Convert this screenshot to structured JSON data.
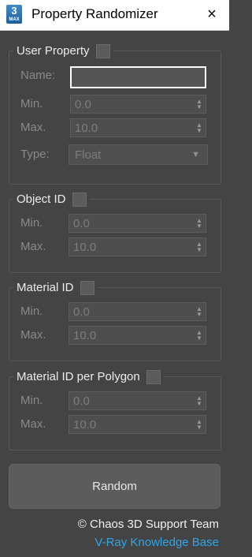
{
  "window": {
    "title": "Property Randomizer",
    "app_icon_main": "3",
    "app_icon_sub": "MAX",
    "close_icon": "×"
  },
  "user_property": {
    "legend": "User Property",
    "enabled": false,
    "name_label": "Name:",
    "name_value": "",
    "min_label": "Min.",
    "min_value": "0.0",
    "max_label": "Max.",
    "max_value": "10.0",
    "type_label": "Type:",
    "type_value": "Float"
  },
  "object_id": {
    "legend": "Object ID",
    "enabled": false,
    "min_label": "Min.",
    "min_value": "0.0",
    "max_label": "Max.",
    "max_value": "10.0"
  },
  "material_id": {
    "legend": "Material ID",
    "enabled": false,
    "min_label": "Min.",
    "min_value": "0.0",
    "max_label": "Max.",
    "max_value": "10.0"
  },
  "material_id_per_polygon": {
    "legend": "Material ID per Polygon",
    "enabled": false,
    "min_label": "Min.",
    "min_value": "0.0",
    "max_label": "Max.",
    "max_value": "10.0"
  },
  "random_button": "Random",
  "footer": {
    "copyright": "© Chaos 3D Support Team",
    "link": "V-Ray Knowledge Base"
  },
  "colors": {
    "background": "#444444",
    "link": "#2fa7e6",
    "name_input_border": "#ffffff"
  },
  "icons": {
    "app": "3ds-max-icon",
    "close": "close-icon",
    "spinner": "spinner-arrows-icon",
    "dropdown": "dropdown-arrow-icon"
  }
}
